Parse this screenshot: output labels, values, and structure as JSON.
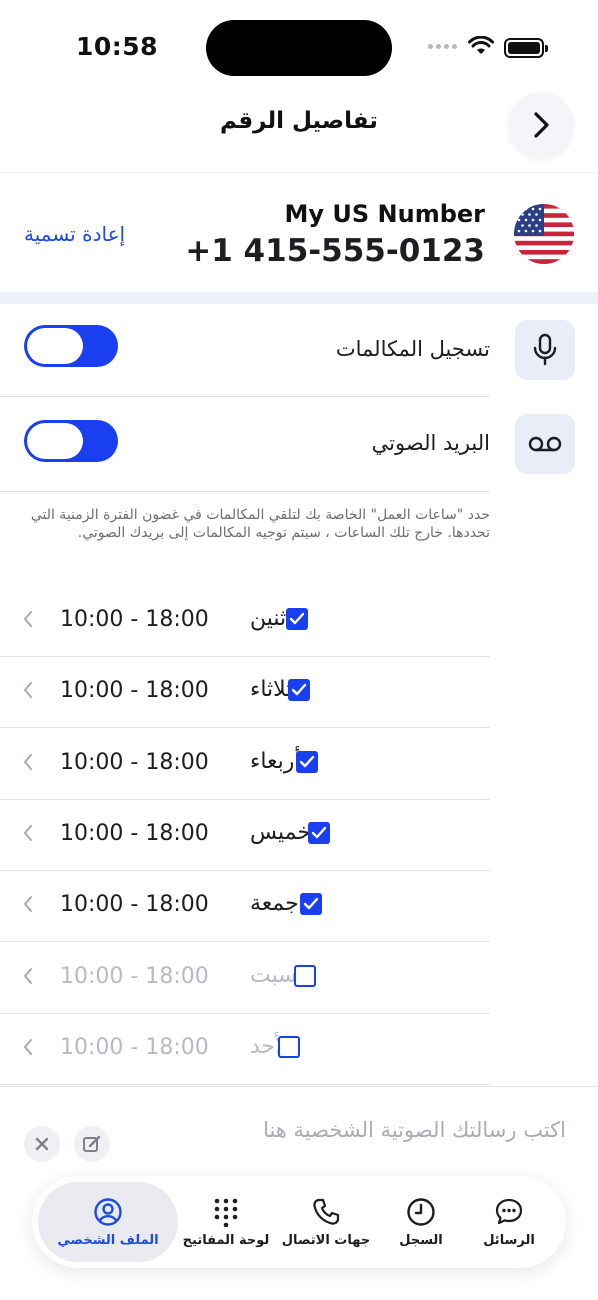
{
  "status_bar": {
    "time": "10:58"
  },
  "header": {
    "title": "تفاصيل الرقم"
  },
  "number": {
    "name": "My US Number",
    "value": "+1 415-555-0123",
    "rename_label": "إعادة تسمية"
  },
  "settings": {
    "call_recording": {
      "label": "تسجيل المكالمات",
      "enabled": true
    },
    "voicemail": {
      "label": "البريد الصوتي",
      "enabled": true
    },
    "hint": "حدد \"ساعات العمل\" الخاصة بك لتلقي المكالمات في غضون الفترة الزمنية التي تحددها. خارج تلك الساعات ، سيتم توجيه المكالمات إلى بريدك الصوتي."
  },
  "schedule": [
    {
      "day": "ثنين",
      "hours": "10:00 - 18:00",
      "checked": true
    },
    {
      "day": "ثلاثاء",
      "hours": "10:00 - 18:00",
      "checked": true
    },
    {
      "day": "أربعاء",
      "hours": "10:00 - 18:00",
      "checked": true
    },
    {
      "day": "خميس",
      "hours": "10:00 - 18:00",
      "checked": true
    },
    {
      "day": "جمعة",
      "hours": "10:00 - 18:00",
      "checked": true
    },
    {
      "day": "السبت",
      "hours": "10:00 - 18:00",
      "checked": false
    },
    {
      "day": "الأحد",
      "hours": "10:00 - 18:00",
      "checked": false
    }
  ],
  "voicemail_message": {
    "placeholder": "اكتب رسالتك الصوتية الشخصية هنا"
  },
  "tabs": [
    {
      "label": "الملف الشخصي",
      "icon": "profile-icon",
      "active": true
    },
    {
      "label": "لوحة المفاتيح",
      "icon": "keypad-icon",
      "active": false
    },
    {
      "label": "جهات الاتصال",
      "icon": "phone-icon",
      "active": false
    },
    {
      "label": "السجل",
      "icon": "clock-icon",
      "active": false
    },
    {
      "label": "الرسائل",
      "icon": "chat-icon",
      "active": false
    }
  ],
  "colors": {
    "accent": "#1a3ff0",
    "link": "#1d4be0",
    "icon_bg": "#e8edf8"
  }
}
